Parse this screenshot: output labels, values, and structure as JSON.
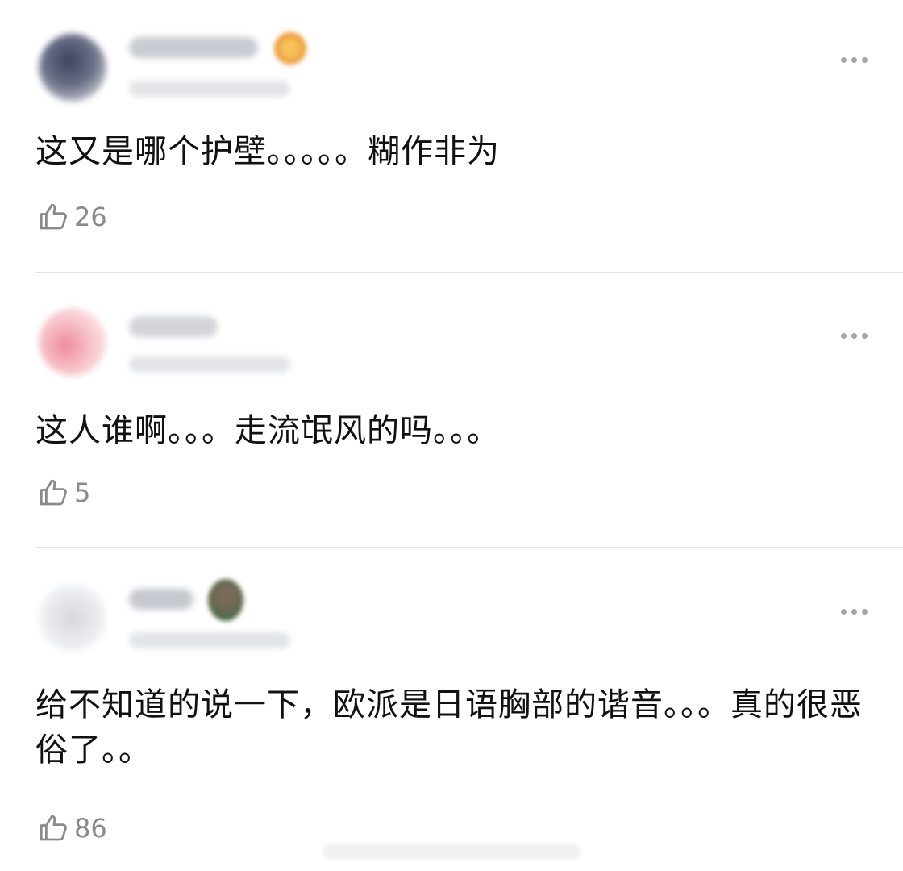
{
  "comments": [
    {
      "text": "这又是哪个护壁。。。。。糊作非为",
      "likes": "26",
      "avatar_color": "#5e6478",
      "badge_color": "#f0a63a"
    },
    {
      "text": "这人谁啊。。。走流氓风的吗。。。",
      "likes": "5",
      "avatar_color": "#f4b3bc",
      "badge_color": ""
    },
    {
      "text": "给不知道的说一下，欧派是日语胸部的谐音。。。真的很恶俗了。。",
      "likes": "86",
      "avatar_color": "#e6e8ec",
      "badge_color": "#4f6a4a"
    }
  ],
  "icons": {
    "more": "more-icon",
    "like": "thumbs-up-icon"
  }
}
